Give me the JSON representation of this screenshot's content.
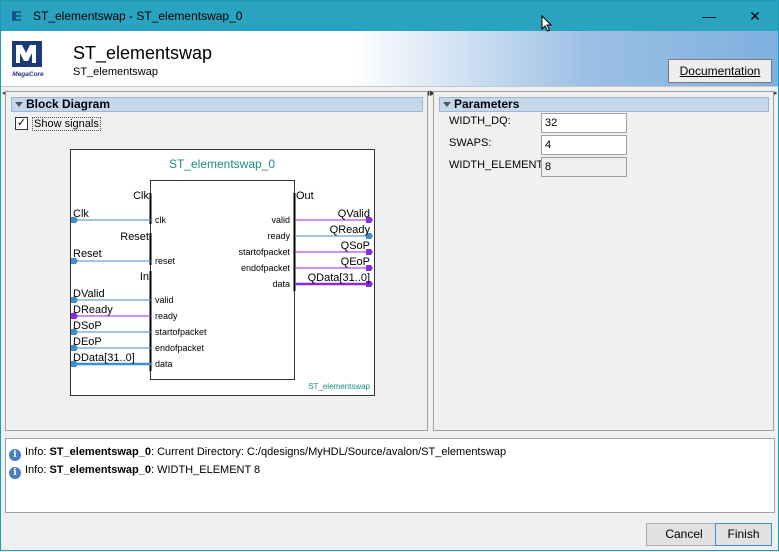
{
  "window": {
    "title": "ST_elementswap - ST_elementswap_0",
    "minimize": "—",
    "close": "✕"
  },
  "header": {
    "logo_text": "MegaCore",
    "title": "ST_elementswap",
    "subtitle": "ST_elementswap",
    "documentation_button": "Documentation"
  },
  "block_diagram": {
    "panel_title": "Block Diagram",
    "show_signals_label": "Show signals",
    "show_signals_checked": true,
    "instance_name": "ST_elementswap_0",
    "module_name": "ST_elementswap",
    "groups": {
      "clk": "Clk",
      "reset": "Reset",
      "in": "In",
      "out": "Out"
    },
    "left_signals": {
      "clk": "Clk",
      "reset": "Reset",
      "dvalid": "DValid",
      "dready": "DReady",
      "dsop": "DSoP",
      "deop": "DEoP",
      "ddata": "DData[31..0]"
    },
    "left_ports": {
      "clk": "clk",
      "reset": "reset",
      "valid": "valid",
      "ready": "ready",
      "startofpacket": "startofpacket",
      "endofpacket": "endofpacket",
      "data": "data"
    },
    "right_ports": {
      "valid": "valid",
      "ready": "ready",
      "startofpacket": "startofpacket",
      "endofpacket": "endofpacket",
      "data": "data"
    },
    "right_signals": {
      "qvalid": "QValid",
      "qready": "QReady",
      "qsop": "QSoP",
      "qeop": "QEoP",
      "qdata": "QData[31..0]"
    },
    "colors": {
      "blue_wire": "#3b8ed0",
      "purple_wire": "#8a2be2",
      "teal_text": "#1a8a8a"
    }
  },
  "parameters": {
    "panel_title": "Parameters",
    "items": [
      {
        "label": "WIDTH_DQ:",
        "value": "32",
        "editable": true
      },
      {
        "label": "SWAPS:",
        "value": "4",
        "editable": true
      },
      {
        "label": "WIDTH_ELEMENT:",
        "value": "8",
        "editable": false
      }
    ]
  },
  "messages": [
    {
      "prefix": "Info: ",
      "source": "ST_elementswap_0",
      "text": ": Current Directory: C:/qdesigns/MyHDL/Source/avalon/ST_elementswap"
    },
    {
      "prefix": "Info: ",
      "source": "ST_elementswap_0",
      "text": ": WIDTH_ELEMENT 8"
    }
  ],
  "footer": {
    "cancel": "Cancel",
    "finish": "Finish"
  }
}
